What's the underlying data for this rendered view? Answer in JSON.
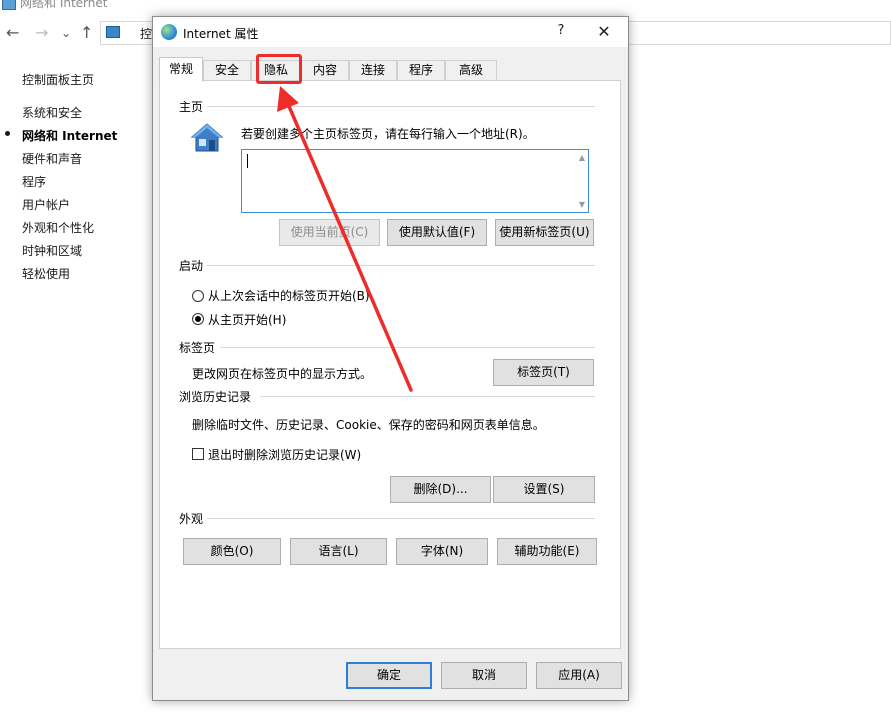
{
  "background": {
    "window_title": "网络和 Internet",
    "address_text": "控",
    "nav": {
      "back": "←",
      "forward": "→",
      "dropdown": "⌄",
      "up": "↑"
    },
    "sidebar": {
      "items": [
        {
          "label": "控制面板主页"
        },
        {
          "label": "系统和安全"
        },
        {
          "label": "网络和 Internet",
          "active": true
        },
        {
          "label": "硬件和声音"
        },
        {
          "label": "程序"
        },
        {
          "label": "用户帐户"
        },
        {
          "label": "外观和个性化"
        },
        {
          "label": "时钟和区域"
        },
        {
          "label": "轻松使用"
        }
      ]
    }
  },
  "dialog": {
    "title": "Internet 属性",
    "help": "?",
    "close": "✕",
    "tabs": [
      {
        "label": "常规",
        "active": true
      },
      {
        "label": "安全"
      },
      {
        "label": "隐私",
        "highlighted": true
      },
      {
        "label": "内容"
      },
      {
        "label": "连接"
      },
      {
        "label": "程序"
      },
      {
        "label": "高级"
      }
    ],
    "home": {
      "section": "主页",
      "instruction": "若要创建多个主页标签页，请在每行输入一个地址(R)。",
      "textarea_value": "",
      "use_current": "使用当前页(C)",
      "use_default": "使用默认值(F)",
      "use_new_tab": "使用新标签页(U)"
    },
    "startup": {
      "section": "启动",
      "option_last_session": "从上次会话中的标签页开始(B)",
      "option_home": "从主页开始(H)",
      "selected": "option_home"
    },
    "tabs_section": {
      "section": "标签页",
      "description": "更改网页在标签页中的显示方式。",
      "button": "标签页(T)"
    },
    "history": {
      "section": "浏览历史记录",
      "description": "删除临时文件、历史记录、Cookie、保存的密码和网页表单信息。",
      "delete_on_exit": "退出时删除浏览历史记录(W)",
      "delete_on_exit_checked": false,
      "delete_button": "删除(D)...",
      "settings_button": "设置(S)"
    },
    "appearance": {
      "section": "外观",
      "colors": "颜色(O)",
      "languages": "语言(L)",
      "fonts": "字体(N)",
      "accessibility": "辅助功能(E)"
    },
    "footer": {
      "ok": "确定",
      "cancel": "取消",
      "apply": "应用(A)"
    }
  },
  "annotation": {
    "color": "#ee2c2c"
  }
}
